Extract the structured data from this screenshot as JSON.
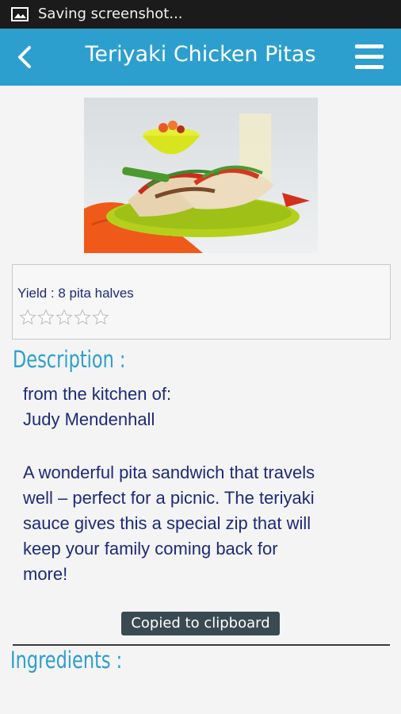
{
  "status_bar": {
    "text": "Saving screenshot..."
  },
  "app_bar": {
    "title": "Teriyaki Chicken Pitas"
  },
  "recipe": {
    "yield": "Yield :  8 pita halves",
    "rating": 0,
    "rating_max": 5
  },
  "description": {
    "heading": "Description :",
    "from_line": "from the kitchen of:",
    "author": "Judy Mendenhall",
    "body_lines": [
      "A wonderful pita sandwich that travels",
      "well – perfect for a picnic. The teriyaki",
      "sauce gives this a special zip that will",
      "keep your family coming back for",
      "more!"
    ]
  },
  "toast": {
    "text": "Copied to clipboard"
  },
  "ingredients": {
    "heading": "Ingredients :"
  },
  "colors": {
    "accent": "#2c9fce",
    "text": "#1e2a78",
    "status_bar": "#1b1b1b"
  }
}
